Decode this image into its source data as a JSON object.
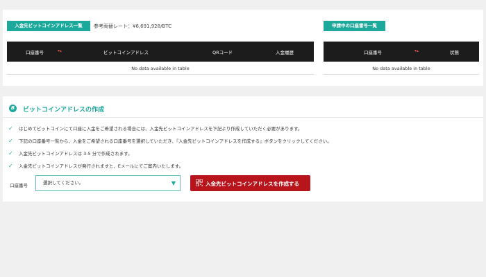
{
  "address_list": {
    "tag": "入金先ビットコインアドレス一覧",
    "rate_text": "参考両替レート：¥6,691,928/BTC",
    "columns": [
      "口座番号",
      "ビットコインアドレス",
      "QRコード",
      "入金履歴"
    ],
    "empty_text": "No data available in table"
  },
  "pending_list": {
    "tag": "申請中の口座番号一覧",
    "columns": [
      "口座番号",
      "状態"
    ],
    "empty_text": "No data available in table"
  },
  "create_section": {
    "badge": "B",
    "title": "ビットコインアドレスの作成",
    "notes": [
      "はじめてビットコインにて口座に入金をご希望される場合には、入金先ビットコインアドレスを下記より作成していただく必要があります。",
      "下記の口座番号一覧から、入金をご希望される口座番号を選択していただき、『入金先ビットコインアドレスを作成する』ボタンをクリックしてください。",
      "入金先ビットコインアドレスは 3-5 分で作成されます。",
      "入金先ビットコインアドレスが発行されますと、Eメールにてご案内いたします。"
    ],
    "account_label": "口座番号",
    "select_placeholder": "選択してください。",
    "create_button": "入金先ビットコインアドレスを作成する"
  },
  "colors": {
    "accent": "#1ca89b",
    "header_bg": "#1c1c1c",
    "button": "#b8141b"
  }
}
